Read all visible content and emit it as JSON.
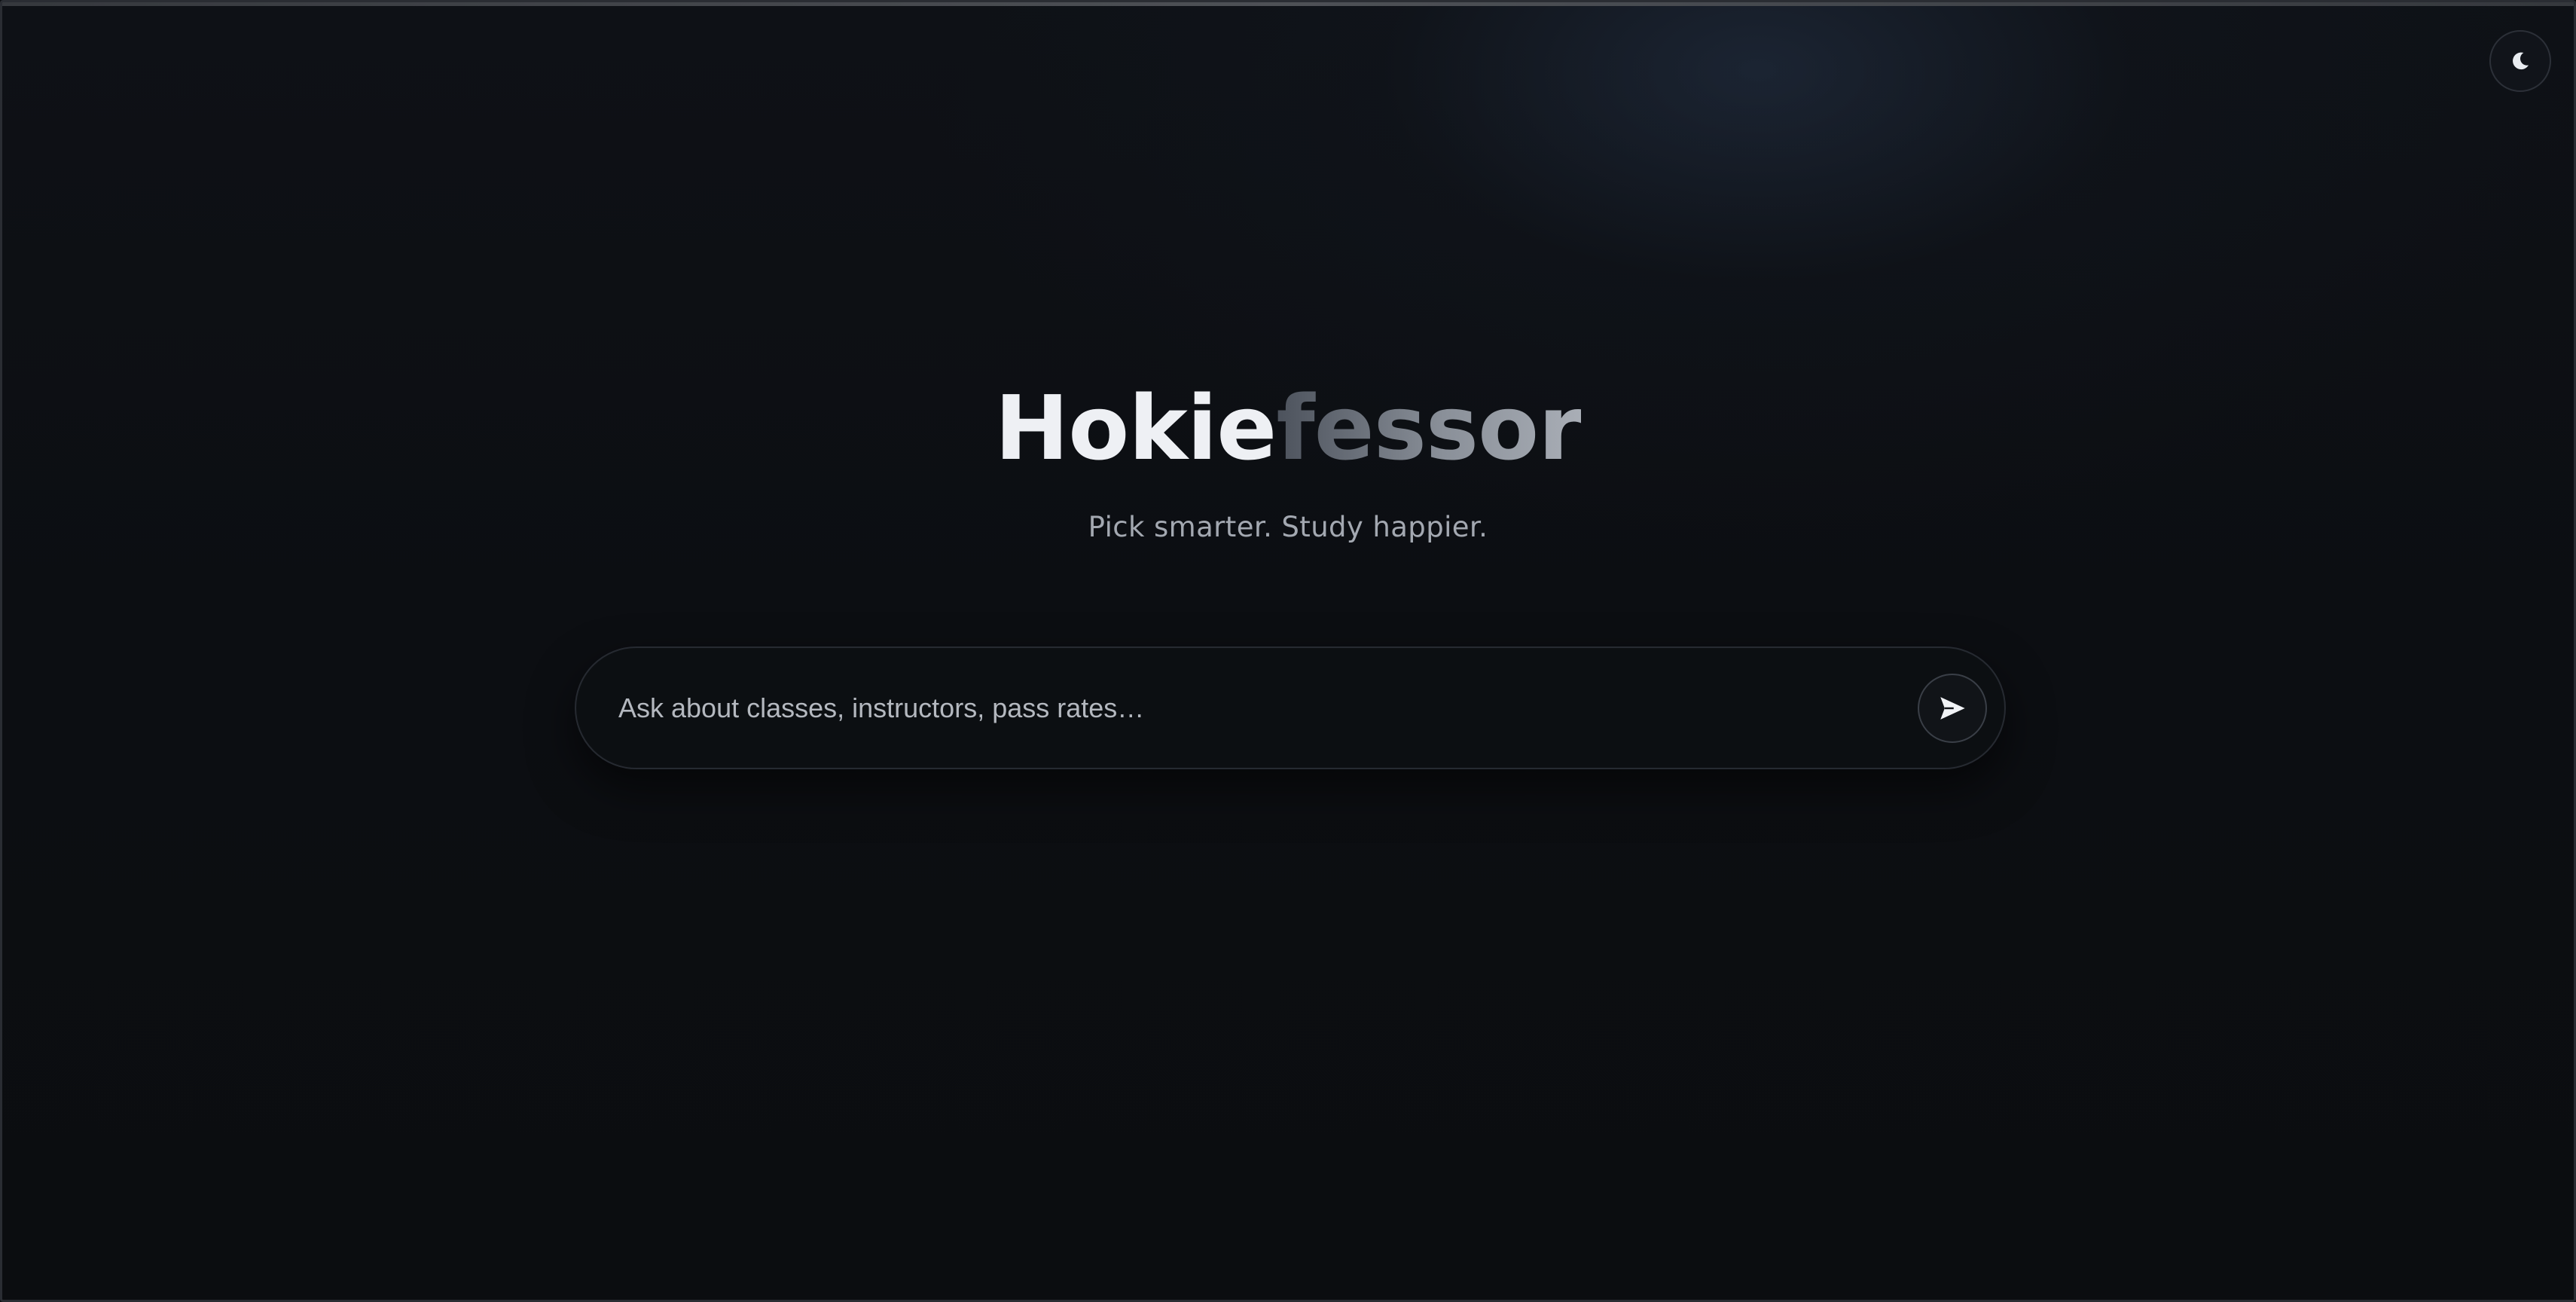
{
  "brand": {
    "part1": "Hokie",
    "part2": "fessor"
  },
  "tagline": "Pick smarter. Study happier.",
  "search": {
    "placeholder": "Ask about classes, instructors, pass rates…",
    "value": ""
  },
  "icons": {
    "theme_toggle": "moon-icon",
    "send": "send-icon"
  },
  "colors": {
    "background": "#0b0d11",
    "brand_primary": "#eef0f4",
    "brand_secondary": "#8a9099",
    "tagline": "#a3a8b1"
  }
}
